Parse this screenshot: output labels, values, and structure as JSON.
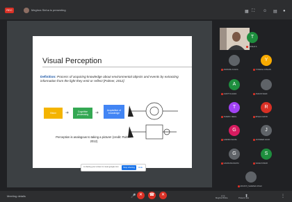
{
  "header": {
    "rec_badge": "REC",
    "presenter_text": "Meghna Sinha is presenting",
    "icons": [
      "layout-icon",
      "fullscreen-icon",
      "people-icon",
      "chat-icon",
      "account-icon"
    ]
  },
  "slide": {
    "title": "Visual Perception",
    "definition_label": "Definition:",
    "definition_text": "Process of acquiring knowledge about environmental objects and events by extracting information from the light they emit or reflect [Palmer, 2012].",
    "boxes": [
      "Vision",
      "Cognitive processing",
      "Acquisition of knowledge"
    ],
    "perception_text": "Perception is analogous to taking a picture! (credit: Palmer, 2012)"
  },
  "share_bar": {
    "text": "is sharing your screen to meet.google.com",
    "stop": "Stop sharing",
    "hide": "Hide"
  },
  "participants": [
    {
      "initial": "T",
      "color": "#1e8e3e",
      "name": "TRISHA S."
    },
    {
      "initial": "",
      "color": "#5f6368",
      "name": "ANIRUDH KULKA"
    },
    {
      "initial": "Y",
      "color": "#f9ab00",
      "name": "YOGESH JOSHAN"
    },
    {
      "initial": "A",
      "color": "#1e8e3e",
      "name": "AADITYA AGRA"
    },
    {
      "initial": "",
      "color": "#5f6368",
      "name": "AMAAN SHEK"
    },
    {
      "initial": "T",
      "color": "#a142f4",
      "name": "TANMAY NEGIL"
    },
    {
      "initial": "R",
      "color": "#d93025",
      "name": "RISHA KHATR"
    },
    {
      "initial": "G",
      "color": "#d81b60",
      "name": "GARIMA SHUKL"
    },
    {
      "initial": "J",
      "color": "#5f6368",
      "name": "JATINDER KAUR"
    },
    {
      "initial": "G",
      "color": "#5f6368",
      "name": "GAURANG DHOM"
    },
    {
      "initial": "S",
      "color": "#1e8e3e",
      "name": "SAGE KUMAR"
    },
    {
      "initial": "",
      "color": "#5f6368",
      "name": "MOUSTI_SHARMA JOSHI"
    }
  ],
  "footer": {
    "meeting_details": "Meeting details",
    "labels": [
      "Meghna Sinha",
      "Present now"
    ]
  }
}
